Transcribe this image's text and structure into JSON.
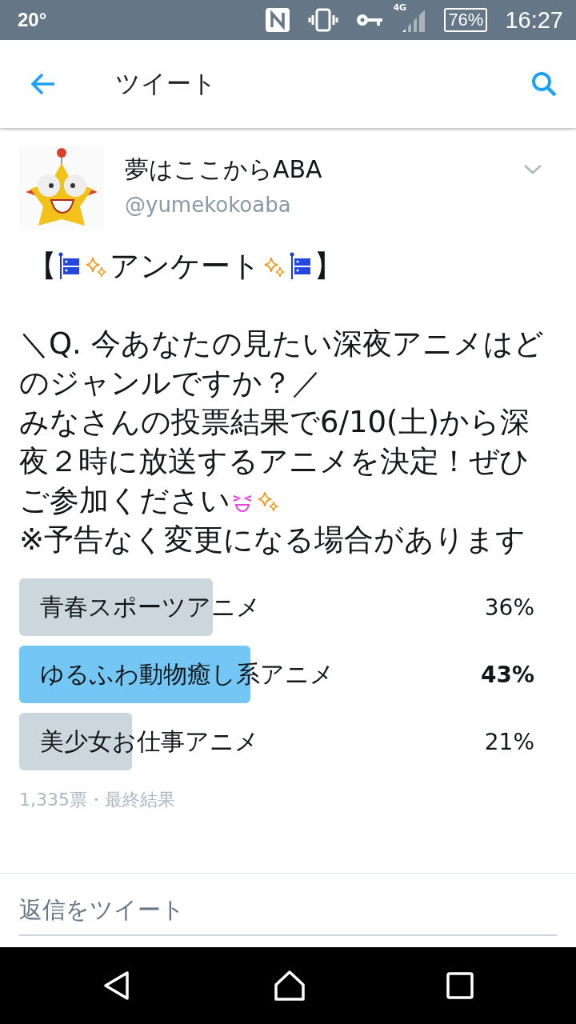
{
  "status_bar": {
    "temperature": "20°",
    "network": "4G",
    "battery": "76%",
    "time": "16:27"
  },
  "app_bar": {
    "title": "ツイート"
  },
  "tweet": {
    "display_name": "夢はここからABA",
    "handle": "@yumekokoaba",
    "heading": [
      {
        "kind": "text",
        "text": "【"
      },
      {
        "kind": "streamer"
      },
      {
        "kind": "sparkles"
      },
      {
        "kind": "text",
        "text": "アンケート"
      },
      {
        "kind": "sparkles"
      },
      {
        "kind": "streamer"
      },
      {
        "kind": "text",
        "text": "】"
      }
    ],
    "paragraphs": [
      [
        {
          "kind": "text",
          "text": "＼Q. 今あなたの見たい深夜アニメはどのジャンルですか？／"
        }
      ],
      [
        {
          "kind": "text",
          "text": "みなさんの投票結果で6/10(土)から深夜２時に放送するアニメを決定！ぜひご参加ください"
        },
        {
          "kind": "face"
        },
        {
          "kind": "sparkles"
        }
      ],
      [
        {
          "kind": "text",
          "text": "※予告なく変更になる場合があります"
        }
      ]
    ],
    "poll": {
      "options": [
        {
          "label": "青春スポーツアニメ",
          "percent": "36%",
          "winner": false
        },
        {
          "label": "ゆるふわ動物癒し系アニメ",
          "percent": "43%",
          "winner": true
        },
        {
          "label": "美少女お仕事アニメ",
          "percent": "21%",
          "winner": false
        }
      ],
      "summary": "1,335票・最終結果"
    }
  },
  "reply": {
    "placeholder": "返信をツイート"
  }
}
